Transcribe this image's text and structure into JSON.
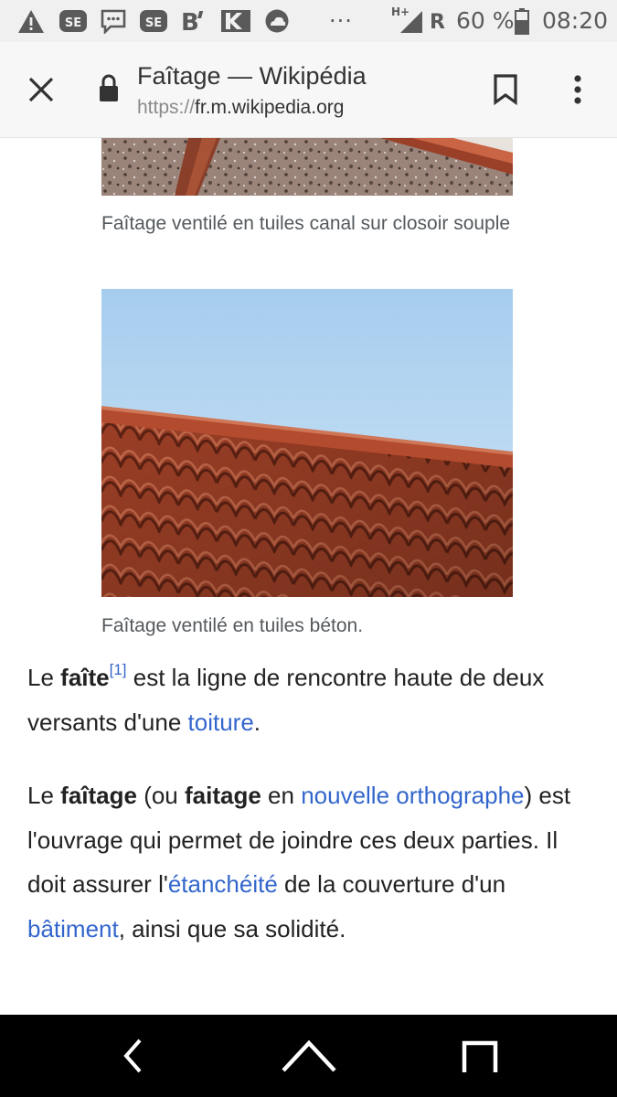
{
  "status_bar": {
    "left_icons": [
      "warning-icon",
      "se-app-icon",
      "message-icon",
      "se-app-icon",
      "b-app-icon",
      "k-app-icon",
      "weather-icon"
    ],
    "more": "···",
    "network": "H+",
    "roaming": "R",
    "battery": "60 %",
    "time": "08:20"
  },
  "browser": {
    "title": "Faîtage — Wikipédia",
    "url_scheme": "https://",
    "url_host": "fr.m.wikipedia.org"
  },
  "article": {
    "caption_1": "Faîtage ventilé en tuiles canal sur closoir souple",
    "caption_2": "Faîtage ventilé en tuiles béton.",
    "p1": {
      "t1": "Le ",
      "b1": "faîte",
      "ref": "[1]",
      "t2": " est la ligne de rencontre haute de deux versants d'une ",
      "link1": "toiture",
      "t3": "."
    },
    "p2": {
      "t1": "Le ",
      "b1": "faîtage",
      "t2": " (ou ",
      "b2": "faitage",
      "t3": " en ",
      "link1": "nouvelle orthographe",
      "t4": ") est l'ouvrage qui permet de joindre ces deux parties. Il doit assurer l'",
      "link2": "étanchéité",
      "t5": " de la couverture d'un ",
      "link3": "bâtiment",
      "t6": ", ainsi que sa solidité."
    }
  },
  "colors": {
    "link": "#3366cc",
    "text": "#222222",
    "caption": "#54595d",
    "toolbar_bg": "#f7f7f7",
    "status_bg": "#f0f0f0"
  }
}
